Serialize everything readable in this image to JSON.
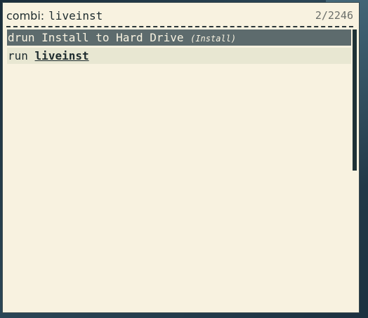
{
  "launcher": {
    "mode": "combi",
    "separator": ":",
    "query": "liveinst",
    "counter": "2/2246"
  },
  "results": [
    {
      "prefix": "drun",
      "name": "Install to Hard Drive",
      "sub": "(Install)",
      "selected": true
    },
    {
      "prefix": "run",
      "name": "liveinst",
      "selected": false
    }
  ],
  "colors": {
    "background": "#f8f2e0",
    "selected_row": "#5d6b6d",
    "normal_row": "#e8e7d2",
    "text": "#1d2b2e",
    "scrollbar": "#1f3236"
  }
}
